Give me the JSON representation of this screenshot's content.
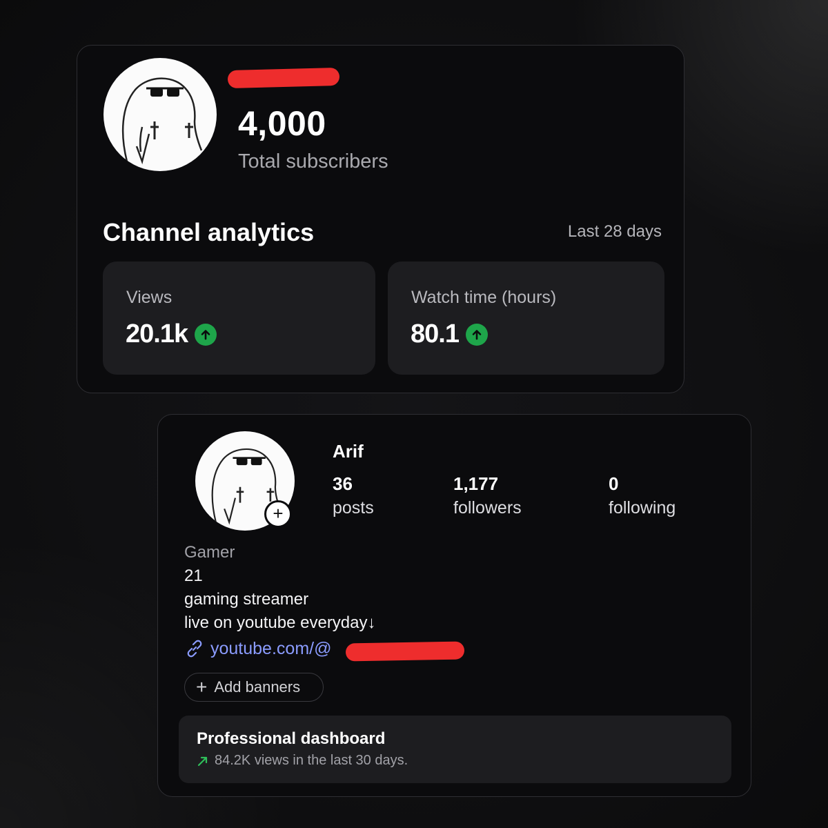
{
  "channel": {
    "subscriber_count": "4,000",
    "subscriber_label": "Total subscribers",
    "analytics_title": "Channel analytics",
    "range_label": "Last 28 days",
    "metrics": [
      {
        "label": "Views",
        "value": "20.1k",
        "trend": "up"
      },
      {
        "label": "Watch time (hours)",
        "value": "80.1",
        "trend": "up"
      }
    ],
    "trend_color": "#1ea54a"
  },
  "profile": {
    "username": "Arif",
    "stats": [
      {
        "value": "36",
        "label": "posts"
      },
      {
        "value": "1,177",
        "label": "followers"
      },
      {
        "value": "0",
        "label": "following"
      }
    ],
    "category": "Gamer",
    "bio_lines": [
      "21",
      "gaming streamer",
      "live on youtube everyday↓"
    ],
    "link_text": "youtube.com/@",
    "link_color": "#8b9cff",
    "add_banners_label": "Add banners",
    "dashboard": {
      "title": "Professional dashboard",
      "subtitle": "84.2K views in the last 30 days."
    }
  },
  "icons": [
    "avatar-image",
    "arrow-up-circle-icon",
    "plus-icon",
    "link-icon",
    "trend-up-arrow-icon"
  ]
}
